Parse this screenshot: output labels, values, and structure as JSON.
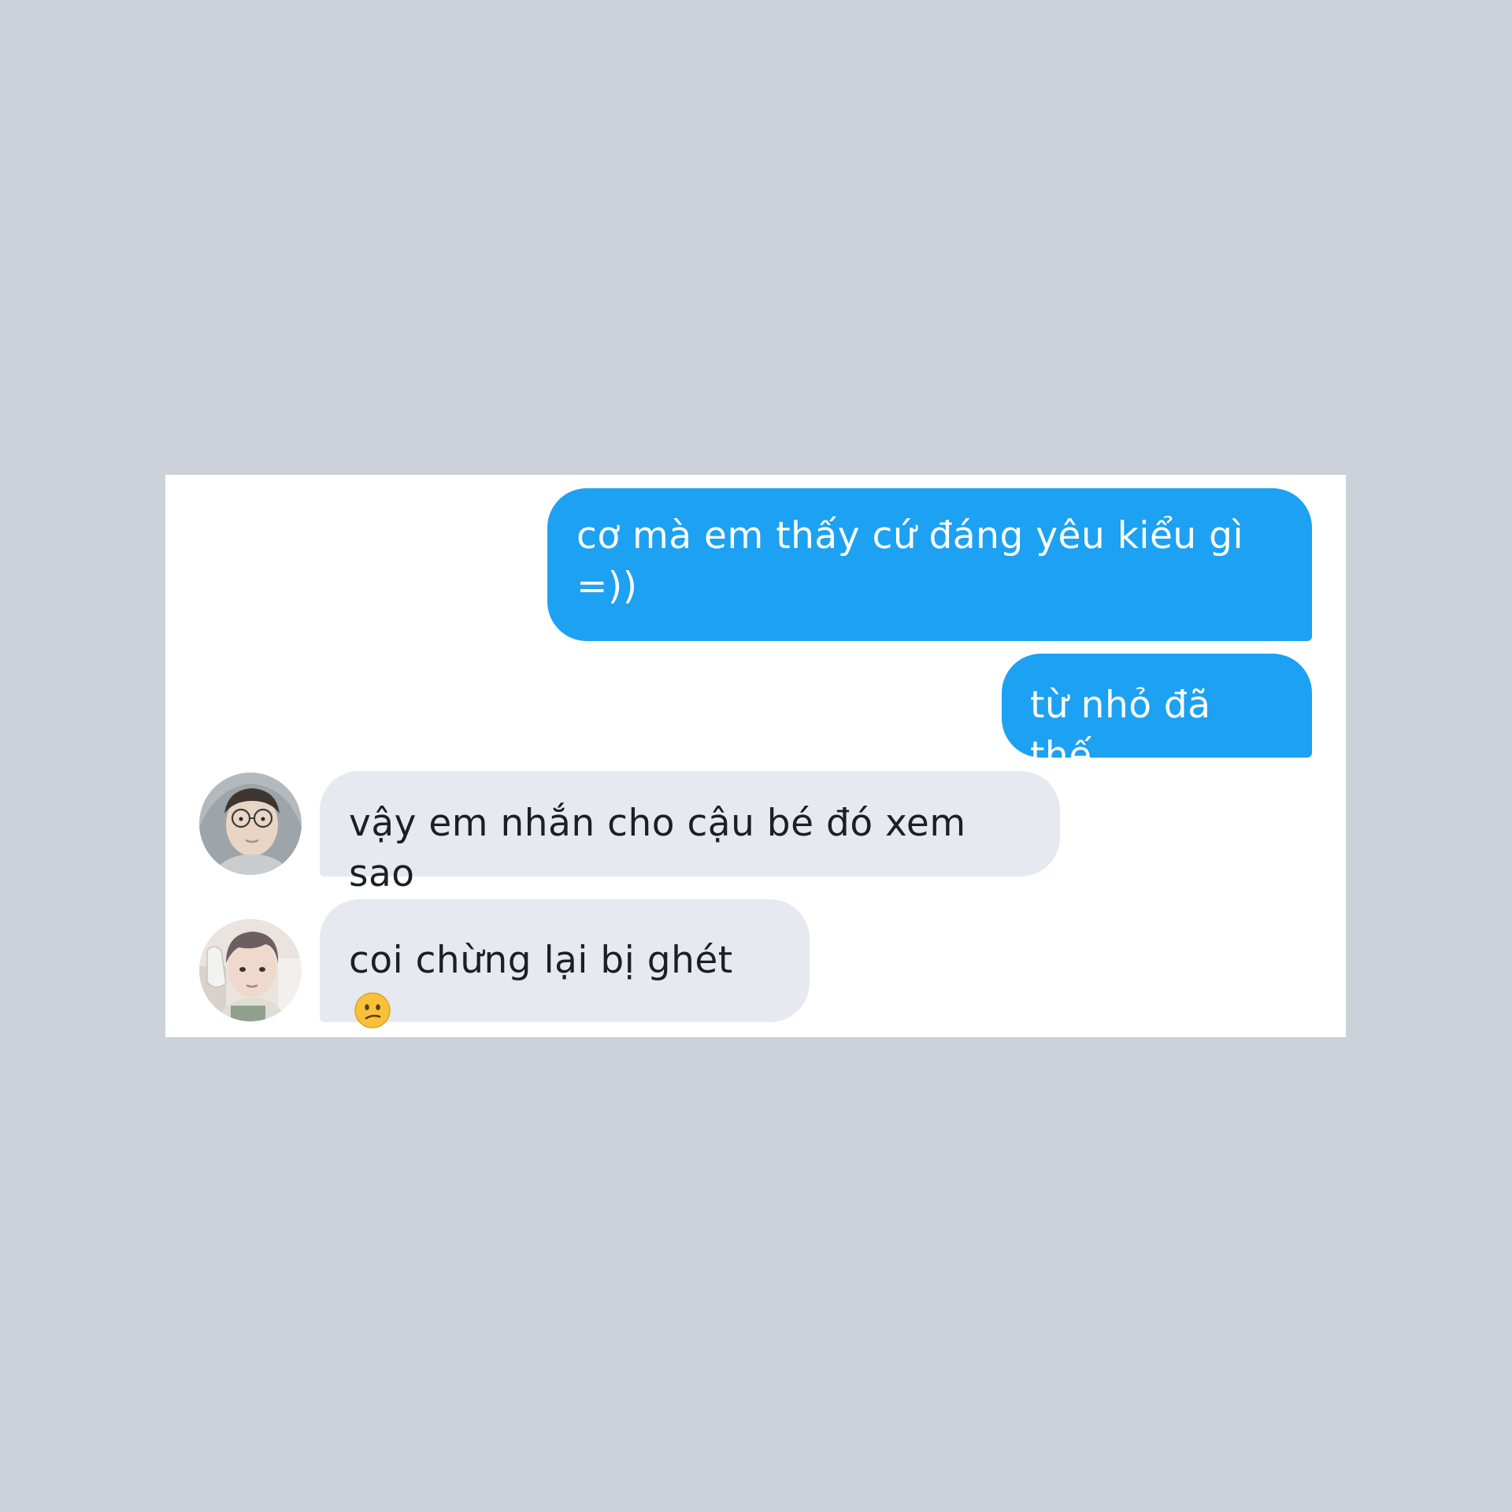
{
  "conversation": {
    "messages": [
      {
        "direction": "outgoing",
        "text": "cơ mà em thấy cứ đáng yêu kiểu gì =))"
      },
      {
        "direction": "outgoing",
        "text": "từ nhỏ đã thế"
      },
      {
        "direction": "incoming",
        "text": "vậy em nhắn cho cậu bé đó xem sao"
      },
      {
        "direction": "incoming",
        "text": "coi chừng lại bị ghét",
        "emoji": "confused-face-icon"
      }
    ]
  },
  "colors": {
    "page_background": "#cdd1d9",
    "panel_background": "#ffffff",
    "outgoing_bubble": "#1da1f2",
    "incoming_bubble": "#e6e9ef",
    "incoming_text": "#1c1f23"
  }
}
